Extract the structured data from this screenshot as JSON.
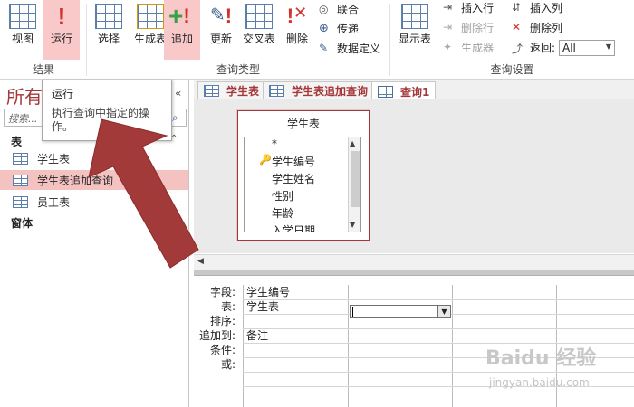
{
  "ribbon": {
    "groups": {
      "results": "结果",
      "query_type": "查询类型",
      "query_setup": "查询设置"
    },
    "buttons": {
      "view": "视图",
      "run": "运行",
      "select": "选择",
      "make_table": "生成表",
      "append": "追加",
      "update": "更新",
      "crosstab": "交叉表",
      "delete": "删除",
      "union": "联合",
      "pass_through": "传递",
      "data_definition": "数据定义",
      "show_table": "显示表",
      "insert_rows": "插入行",
      "delete_rows": "删除行",
      "builder": "生成器",
      "insert_columns": "插入列",
      "delete_columns": "删除列",
      "return_label": "返回:",
      "return_value": "All"
    }
  },
  "nav": {
    "title": "所有",
    "search_placeholder": "搜索...",
    "section_tables": "表",
    "items": [
      "学生表",
      "学生表追加查询",
      "员工表"
    ],
    "section_forms": "窗体"
  },
  "tooltip": {
    "title": "运行",
    "body": "执行查询中指定的操作。"
  },
  "tabs": [
    "学生表",
    "学生表追加查询",
    "查询1"
  ],
  "table_box": {
    "title": "学生表",
    "fields": [
      "*",
      "学生编号",
      "学生姓名",
      "性别",
      "年龄",
      "入学日期"
    ]
  },
  "qbe": {
    "row_labels": [
      "字段:",
      "表:",
      "排序:",
      "追加到:",
      "条件:",
      "或:"
    ],
    "col1": {
      "field": "学生编号",
      "table": "学生表",
      "append_to": "备注"
    }
  },
  "watermark": {
    "text": "Baidu 经验",
    "sub": "jingyan.baidu.com"
  },
  "colors": {
    "accent": "#a4373a",
    "highlight": "#f9c8c8",
    "arrow": "#a33a3a"
  }
}
